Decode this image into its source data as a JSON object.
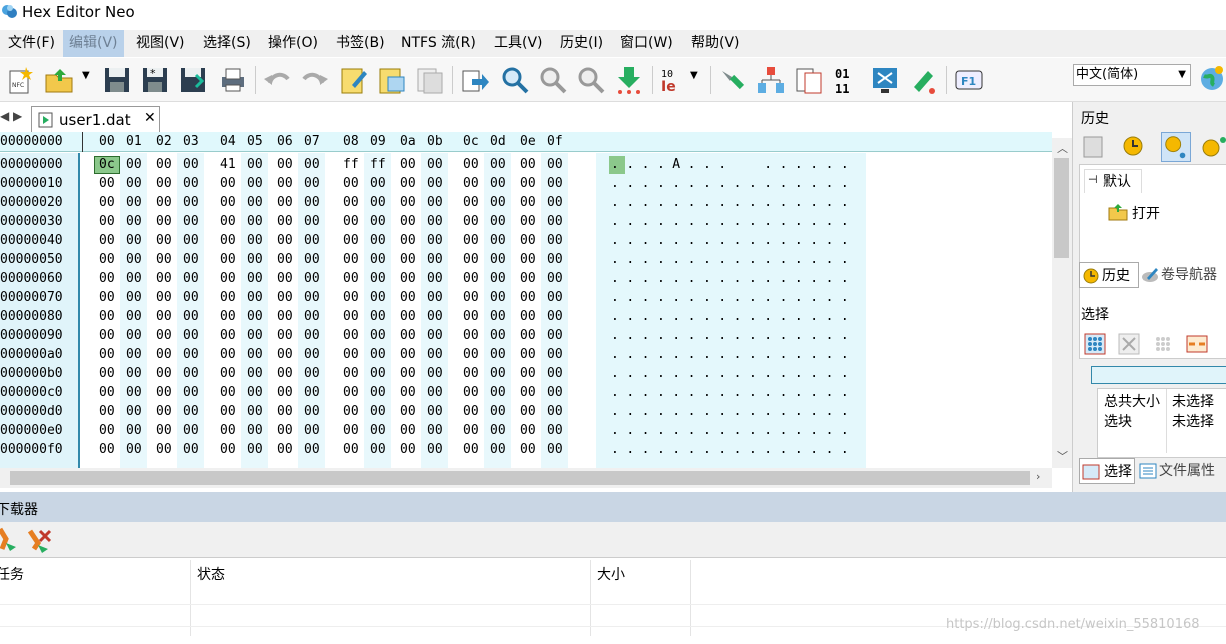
{
  "app": {
    "title": "Hex Editor Neo"
  },
  "menu": [
    "文件(F)",
    "编辑(V)",
    "视图(V)",
    "选择(S)",
    "操作(O)",
    "书签(B)",
    "NTFS 流(R)",
    "工具(V)",
    "历史(I)",
    "窗口(W)",
    "帮助(V)"
  ],
  "language": {
    "selected": "中文(简体)"
  },
  "tab": {
    "label": "user1.dat",
    "close": "✕"
  },
  "hex": {
    "header_addr": "00000000",
    "columns": [
      "00",
      "01",
      "02",
      "03",
      "04",
      "05",
      "06",
      "07",
      "08",
      "09",
      "0a",
      "0b",
      "0c",
      "0d",
      "0e",
      "0f"
    ],
    "rows": [
      {
        "addr": "00000000",
        "bytes": [
          "0c",
          "00",
          "00",
          "00",
          "41",
          "00",
          "00",
          "00",
          "ff",
          "ff",
          "00",
          "00",
          "00",
          "00",
          "00",
          "00"
        ],
        "text": "....A...  ......"
      },
      {
        "addr": "00000010",
        "bytes": [
          "00",
          "00",
          "00",
          "00",
          "00",
          "00",
          "00",
          "00",
          "00",
          "00",
          "00",
          "00",
          "00",
          "00",
          "00",
          "00"
        ],
        "text": "................"
      },
      {
        "addr": "00000020",
        "bytes": [
          "00",
          "00",
          "00",
          "00",
          "00",
          "00",
          "00",
          "00",
          "00",
          "00",
          "00",
          "00",
          "00",
          "00",
          "00",
          "00"
        ],
        "text": "................"
      },
      {
        "addr": "00000030",
        "bytes": [
          "00",
          "00",
          "00",
          "00",
          "00",
          "00",
          "00",
          "00",
          "00",
          "00",
          "00",
          "00",
          "00",
          "00",
          "00",
          "00"
        ],
        "text": "................"
      },
      {
        "addr": "00000040",
        "bytes": [
          "00",
          "00",
          "00",
          "00",
          "00",
          "00",
          "00",
          "00",
          "00",
          "00",
          "00",
          "00",
          "00",
          "00",
          "00",
          "00"
        ],
        "text": "................"
      },
      {
        "addr": "00000050",
        "bytes": [
          "00",
          "00",
          "00",
          "00",
          "00",
          "00",
          "00",
          "00",
          "00",
          "00",
          "00",
          "00",
          "00",
          "00",
          "00",
          "00"
        ],
        "text": "................"
      },
      {
        "addr": "00000060",
        "bytes": [
          "00",
          "00",
          "00",
          "00",
          "00",
          "00",
          "00",
          "00",
          "00",
          "00",
          "00",
          "00",
          "00",
          "00",
          "00",
          "00"
        ],
        "text": "................"
      },
      {
        "addr": "00000070",
        "bytes": [
          "00",
          "00",
          "00",
          "00",
          "00",
          "00",
          "00",
          "00",
          "00",
          "00",
          "00",
          "00",
          "00",
          "00",
          "00",
          "00"
        ],
        "text": "................"
      },
      {
        "addr": "00000080",
        "bytes": [
          "00",
          "00",
          "00",
          "00",
          "00",
          "00",
          "00",
          "00",
          "00",
          "00",
          "00",
          "00",
          "00",
          "00",
          "00",
          "00"
        ],
        "text": "................"
      },
      {
        "addr": "00000090",
        "bytes": [
          "00",
          "00",
          "00",
          "00",
          "00",
          "00",
          "00",
          "00",
          "00",
          "00",
          "00",
          "00",
          "00",
          "00",
          "00",
          "00"
        ],
        "text": "................"
      },
      {
        "addr": "000000a0",
        "bytes": [
          "00",
          "00",
          "00",
          "00",
          "00",
          "00",
          "00",
          "00",
          "00",
          "00",
          "00",
          "00",
          "00",
          "00",
          "00",
          "00"
        ],
        "text": "................"
      },
      {
        "addr": "000000b0",
        "bytes": [
          "00",
          "00",
          "00",
          "00",
          "00",
          "00",
          "00",
          "00",
          "00",
          "00",
          "00",
          "00",
          "00",
          "00",
          "00",
          "00"
        ],
        "text": "................"
      },
      {
        "addr": "000000c0",
        "bytes": [
          "00",
          "00",
          "00",
          "00",
          "00",
          "00",
          "00",
          "00",
          "00",
          "00",
          "00",
          "00",
          "00",
          "00",
          "00",
          "00"
        ],
        "text": "................"
      },
      {
        "addr": "000000d0",
        "bytes": [
          "00",
          "00",
          "00",
          "00",
          "00",
          "00",
          "00",
          "00",
          "00",
          "00",
          "00",
          "00",
          "00",
          "00",
          "00",
          "00"
        ],
        "text": "................"
      },
      {
        "addr": "000000e0",
        "bytes": [
          "00",
          "00",
          "00",
          "00",
          "00",
          "00",
          "00",
          "00",
          "00",
          "00",
          "00",
          "00",
          "00",
          "00",
          "00",
          "00"
        ],
        "text": "................"
      },
      {
        "addr": "000000f0",
        "bytes": [
          "00",
          "00",
          "00",
          "00",
          "00",
          "00",
          "00",
          "00",
          "00",
          "00",
          "00",
          "00",
          "00",
          "00",
          "00",
          "00"
        ],
        "text": "................"
      }
    ]
  },
  "history": {
    "title": "历史",
    "default_tab": "默认",
    "item": "打开",
    "tab_history": "历史",
    "tab_volume": "卷导航器"
  },
  "selection": {
    "title": "选择",
    "total_size_label": "总共大小",
    "total_size_value": "未选择",
    "blocks_label": "选块",
    "blocks_value": "未选择",
    "tab_selection": "选择",
    "tab_file_props": "文件属性"
  },
  "downloader": {
    "title": "下载器",
    "col_task": "任务",
    "col_status": "状态",
    "col_size": "大小"
  },
  "watermark": "https://blog.csdn.net/weixin_55810168"
}
